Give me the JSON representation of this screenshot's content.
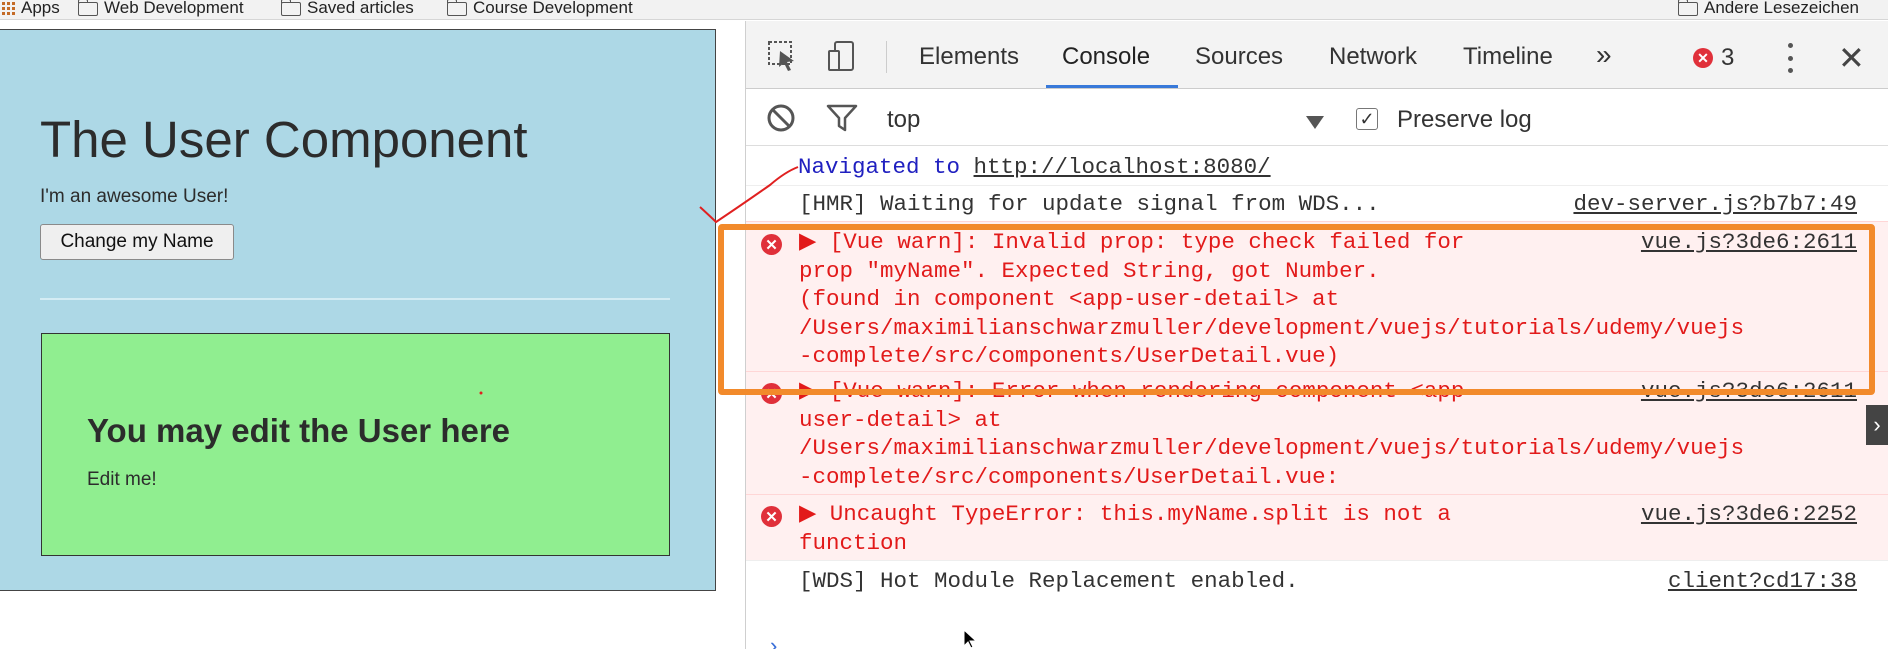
{
  "bookmarks": {
    "apps": "Apps",
    "items": [
      "Web Development",
      "Saved articles",
      "Course Development"
    ],
    "other": "Andere Lesezeichen"
  },
  "page": {
    "title": "The User Component",
    "subtitle": "I'm an awesome User!",
    "button": "Change my Name",
    "detail_title": "You may edit the User here",
    "detail_sub": "Edit me!"
  },
  "devtools": {
    "tabs": [
      "Elements",
      "Console",
      "Sources",
      "Network",
      "Timeline"
    ],
    "active_tab": "Console",
    "more": "»",
    "error_count": "3",
    "filter_context": "top",
    "preserve_log": "Preserve log",
    "preserve_checked": true
  },
  "console": {
    "navigated_prefix": "Navigated to ",
    "navigated_url": "http://localhost:8080/",
    "hmr": "[HMR] Waiting for update signal from WDS...",
    "hmr_src": "dev-server.js?b7b7:49",
    "errors": [
      {
        "text": "▶ [Vue warn]: Invalid prop: type check failed for\nprop \"myName\". Expected String, got Number.\n(found in component <app-user-detail> at\n/Users/maximilianschwarzmuller/development/vuejs/tutorials/udemy/vuejs\n-complete/src/components/UserDetail.vue)",
        "src": "vue.js?3de6:2611"
      },
      {
        "text": "▶ [Vue warn]: Error when rendering component <app-\nuser-detail> at\n/Users/maximilianschwarzmuller/development/vuejs/tutorials/udemy/vuejs\n-complete/src/components/UserDetail.vue:",
        "src": "vue.js?3de6:2611"
      },
      {
        "text": "▶ Uncaught TypeError: this.myName.split is not a\nfunction",
        "src": "vue.js?3de6:2252"
      }
    ],
    "wds": "[WDS] Hot Module Replacement enabled.",
    "wds_src": "client?cd17:38",
    "prompt": "›"
  },
  "colors": {
    "user_bg": "#add8e6",
    "detail_bg": "#90ee90",
    "highlight": "#f28a2b",
    "error_red": "#e21a1a"
  }
}
